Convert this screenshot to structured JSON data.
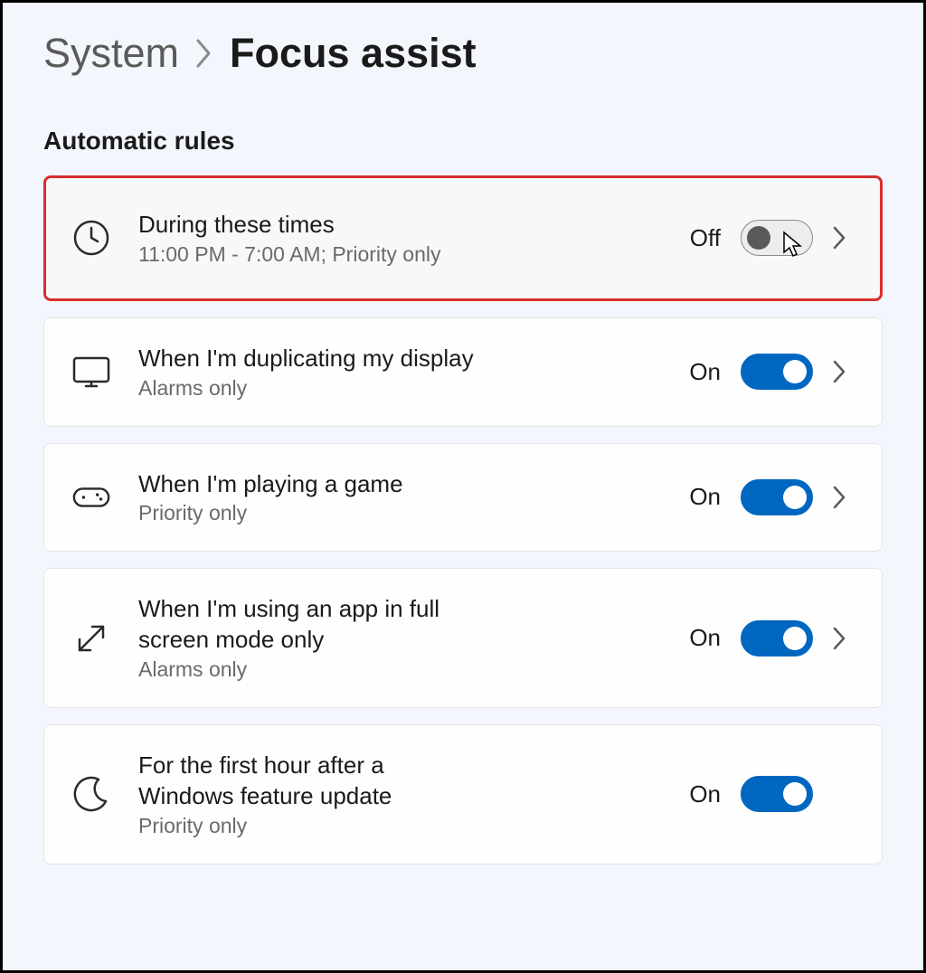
{
  "breadcrumb": {
    "parent": "System",
    "current": "Focus assist"
  },
  "section_title": "Automatic rules",
  "toggle_states": {
    "on": "On",
    "off": "Off"
  },
  "rules": [
    {
      "id": "during-times",
      "title": "During these times",
      "subtitle": "11:00 PM - 7:00 AM; Priority only",
      "state": "off",
      "state_label": "Off",
      "has_chevron": true,
      "highlighted": true,
      "has_cursor": true,
      "icon": "clock"
    },
    {
      "id": "duplicating-display",
      "title": "When I'm duplicating my display",
      "subtitle": "Alarms only",
      "state": "on",
      "state_label": "On",
      "has_chevron": true,
      "highlighted": false,
      "icon": "monitor"
    },
    {
      "id": "playing-game",
      "title": "When I'm playing a game",
      "subtitle": "Priority only",
      "state": "on",
      "state_label": "On",
      "has_chevron": true,
      "highlighted": false,
      "icon": "gamepad"
    },
    {
      "id": "fullscreen-app",
      "title": "When I'm using an app in full screen mode only",
      "subtitle": "Alarms only",
      "state": "on",
      "state_label": "On",
      "has_chevron": true,
      "highlighted": false,
      "icon": "fullscreen"
    },
    {
      "id": "feature-update",
      "title": "For the first hour after a Windows feature update",
      "subtitle": "Priority only",
      "state": "on",
      "state_label": "On",
      "has_chevron": false,
      "highlighted": false,
      "icon": "moon"
    }
  ]
}
